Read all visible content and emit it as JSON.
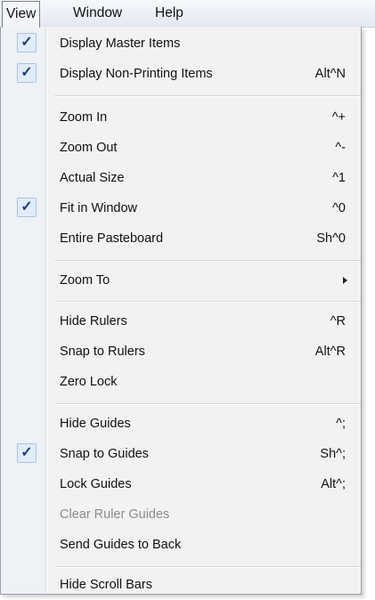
{
  "menubar": {
    "items": [
      {
        "label": "View"
      },
      {
        "label": "Window"
      },
      {
        "label": "Help"
      }
    ]
  },
  "view_menu": {
    "items": [
      {
        "label": "Display Master Items",
        "shortcut": "",
        "checked": true
      },
      {
        "label": "Display Non-Printing Items",
        "shortcut": "Alt^N",
        "checked": true
      },
      {
        "label": "Zoom In",
        "shortcut": "^+",
        "checked": false
      },
      {
        "label": "Zoom Out",
        "shortcut": "^-",
        "checked": false
      },
      {
        "label": "Actual Size",
        "shortcut": "^1",
        "checked": false
      },
      {
        "label": "Fit in Window",
        "shortcut": "^0",
        "checked": true
      },
      {
        "label": "Entire Pasteboard",
        "shortcut": "Sh^0",
        "checked": false
      },
      {
        "label": "Zoom To",
        "shortcut": "",
        "checked": false,
        "submenu": true
      },
      {
        "label": "Hide Rulers",
        "shortcut": "^R",
        "checked": false
      },
      {
        "label": "Snap to Rulers",
        "shortcut": "Alt^R",
        "checked": false
      },
      {
        "label": "Zero Lock",
        "shortcut": "",
        "checked": false
      },
      {
        "label": "Hide Guides",
        "shortcut": "^;",
        "checked": false
      },
      {
        "label": "Snap to Guides",
        "shortcut": "Sh^;",
        "checked": true
      },
      {
        "label": "Lock Guides",
        "shortcut": "Alt^;",
        "checked": false
      },
      {
        "label": "Clear Ruler Guides",
        "shortcut": "",
        "checked": false,
        "disabled": true
      },
      {
        "label": "Send Guides to Back",
        "shortcut": "",
        "checked": false
      },
      {
        "label": "Hide Scroll Bars",
        "shortcut": "",
        "checked": false
      }
    ],
    "check_glyph": "✓",
    "check_icon": "checkmark-icon",
    "submenu_icon": "submenu-arrow-icon"
  },
  "colors": {
    "menu_bg": "#f2f2f2",
    "gutter_bg": "#eef1f5",
    "check_box_bg": "#e1ecf9",
    "check_box_border": "#a9c2e3",
    "check_mark": "#1e3d7b",
    "disabled_text": "#8c8c8c"
  }
}
